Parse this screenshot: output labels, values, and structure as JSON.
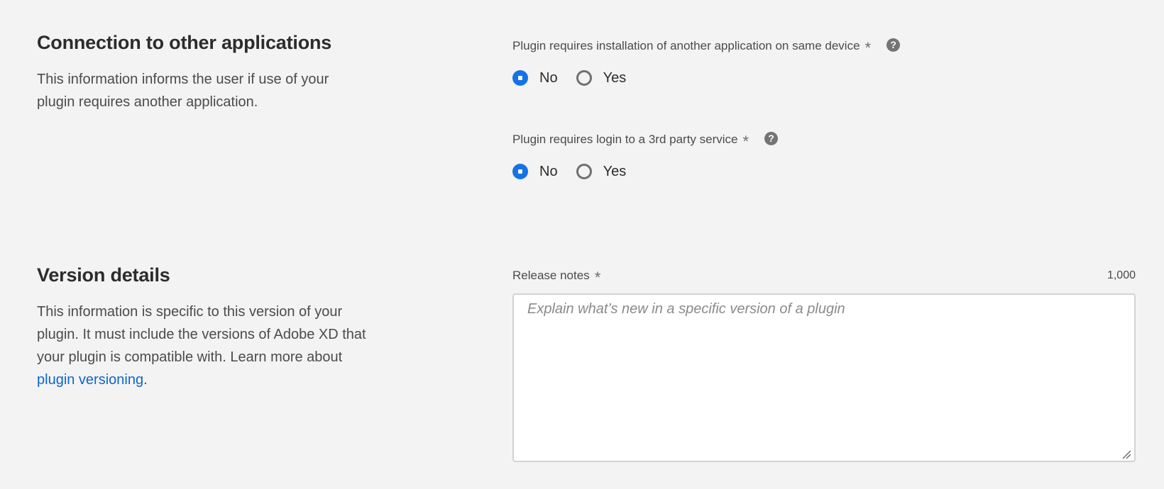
{
  "connection": {
    "title": "Connection to other applications",
    "description": "This information informs the user if use of your plugin requires another application.",
    "fields": [
      {
        "label": "Plugin requires installation of another application on same device",
        "required_mark": "*",
        "help_icon": "question-circle-icon",
        "help_glyph": "?",
        "options": [
          {
            "label": "No",
            "selected": true
          },
          {
            "label": "Yes",
            "selected": false
          }
        ]
      },
      {
        "label": "Plugin requires login to a 3rd party service",
        "required_mark": "*",
        "help_icon": "question-circle-icon",
        "help_glyph": "?",
        "options": [
          {
            "label": "No",
            "selected": true
          },
          {
            "label": "Yes",
            "selected": false
          }
        ]
      }
    ]
  },
  "version": {
    "title": "Version details",
    "description_before_link": "This information is specific to this version of your plugin. It must include the versions of Adobe XD that your plugin is compatible with. Learn more about ",
    "link_text": "plugin versioning",
    "description_after_link": ".",
    "release_notes": {
      "label": "Release notes",
      "required_mark": "*",
      "char_limit": "1,000",
      "value": "",
      "placeholder": "Explain what’s new in a specific version of a plugin"
    }
  },
  "colors": {
    "background": "#f3f3f3",
    "accent": "#1473e6",
    "link": "#0d66d0"
  }
}
